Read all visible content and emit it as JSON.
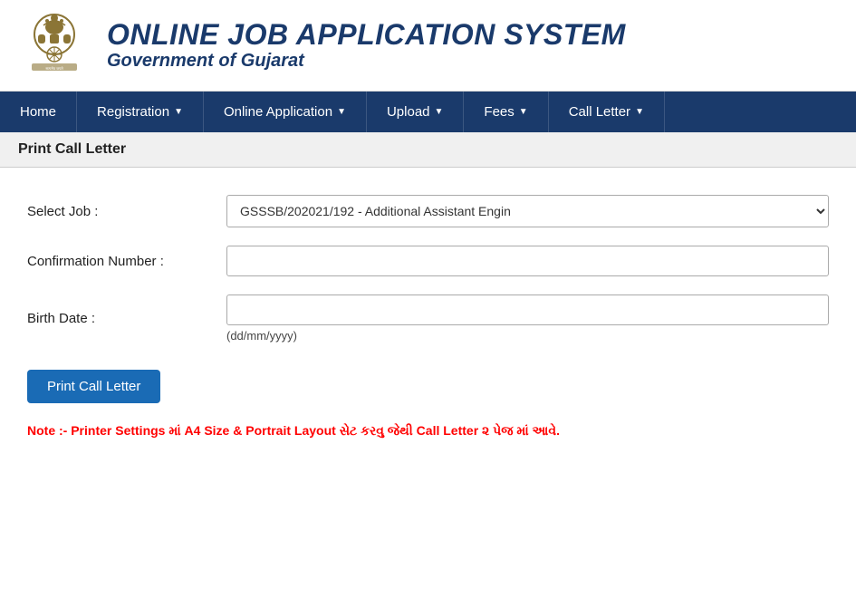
{
  "header": {
    "title": "ONLINE JOB APPLICATION SYSTEM",
    "subtitle": "Government of Gujarat",
    "emblem_alt": "Government Emblem"
  },
  "navbar": {
    "items": [
      {
        "label": "Home",
        "has_arrow": false
      },
      {
        "label": "Registration",
        "has_arrow": true
      },
      {
        "label": "Online Application",
        "has_arrow": true
      },
      {
        "label": "Upload",
        "has_arrow": true
      },
      {
        "label": "Fees",
        "has_arrow": true
      },
      {
        "label": "Call Letter",
        "has_arrow": true
      }
    ]
  },
  "breadcrumb": "Print Call Letter",
  "form": {
    "select_job_label": "Select Job :",
    "select_job_value": "GSSSB/202021/192 - Additional Assistant Engin",
    "confirmation_number_label": "Confirmation Number :",
    "confirmation_number_placeholder": "",
    "birth_date_label": "Birth Date :",
    "birth_date_placeholder": "",
    "birth_date_hint": "(dd/mm/yyyy)",
    "print_button_label": "Print Call Letter"
  },
  "note": "Note :- Printer Settings માં A4 Size & Portrait Layout સેટ કરવુ જેથી Call Letter ૨ પેજ માં આવે."
}
